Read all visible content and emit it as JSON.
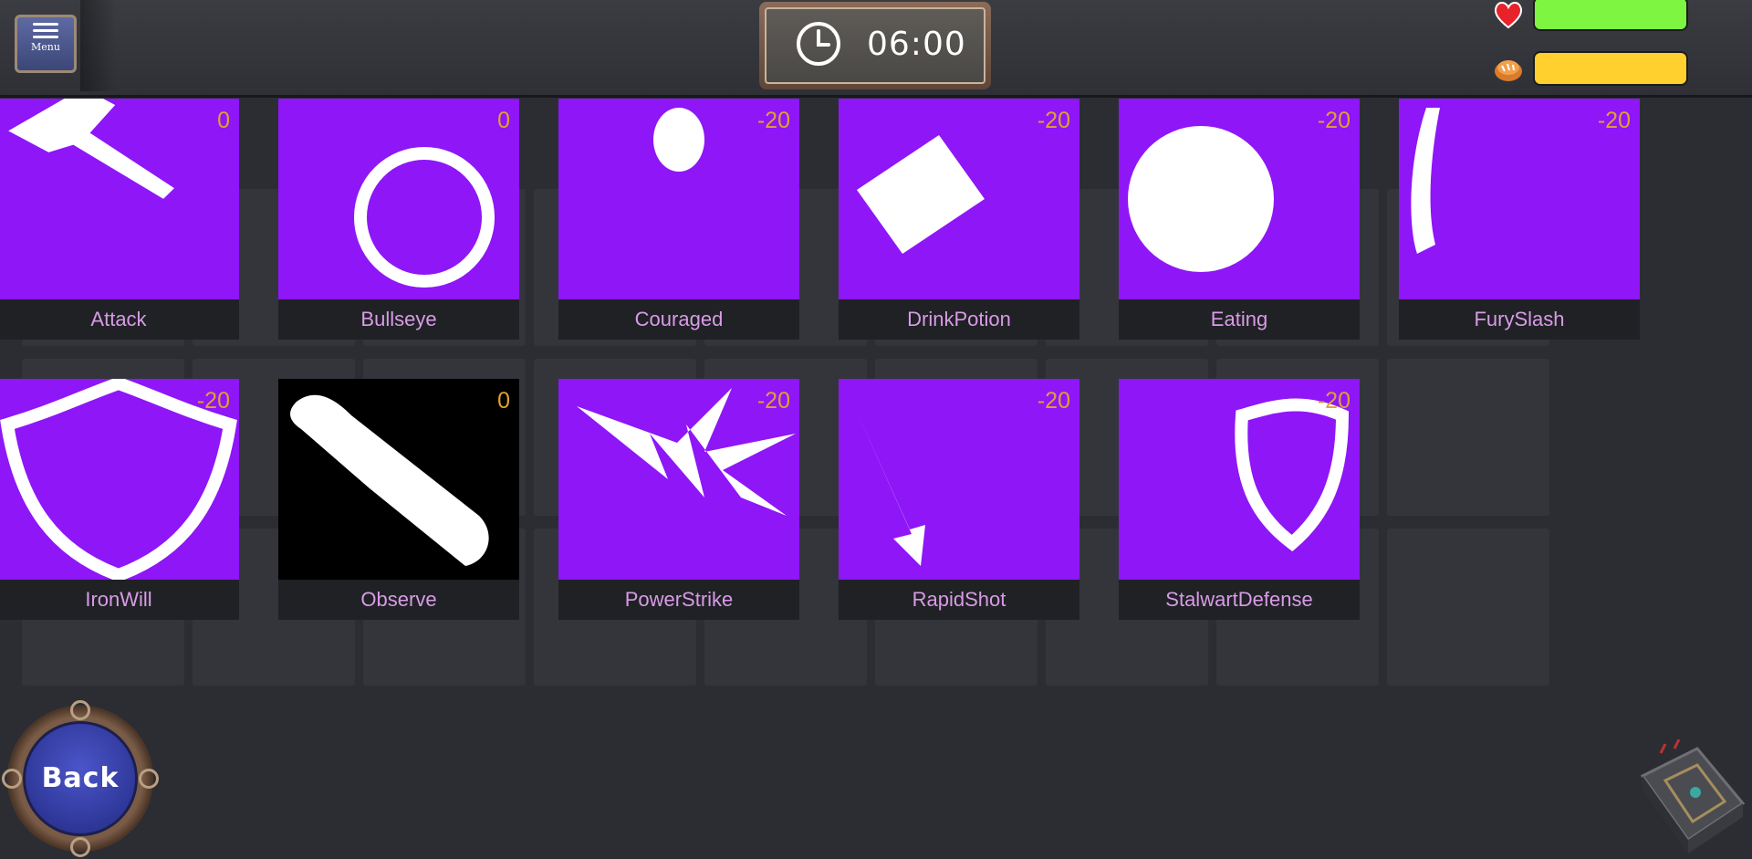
{
  "menu": {
    "label": "Menu",
    "icon": "hamburger-icon"
  },
  "clock": {
    "time": "06:00",
    "icon": "clock-icon"
  },
  "status": {
    "health": {
      "icon": "heart-icon",
      "level": 1.0,
      "color": "#7ef540"
    },
    "food": {
      "icon": "bread-icon",
      "level": 1.0,
      "color": "#ffd02e"
    }
  },
  "skills": [
    {
      "name": "Attack",
      "cost": "0",
      "icon": "sword-grip-icon",
      "bg": "#8e16f7"
    },
    {
      "name": "Bullseye",
      "cost": "0",
      "icon": "bullseye-icon",
      "bg": "#8e16f7"
    },
    {
      "name": "Couraged",
      "cost": "-20",
      "icon": "muscle-icon",
      "bg": "#8e16f7"
    },
    {
      "name": "DrinkPotion",
      "cost": "-20",
      "icon": "potion-icon",
      "bg": "#8e16f7"
    },
    {
      "name": "Eating",
      "cost": "-20",
      "icon": "eating-icon",
      "bg": "#8e16f7"
    },
    {
      "name": "FurySlash",
      "cost": "-20",
      "icon": "slash-icon",
      "bg": "#8e16f7"
    },
    {
      "name": "IronWill",
      "cost": "-20",
      "icon": "shield-arrow-icon",
      "bg": "#8e16f7"
    },
    {
      "name": "Observe",
      "cost": "0",
      "icon": "spyglass-icon",
      "bg": "#000000"
    },
    {
      "name": "PowerStrike",
      "cost": "-20",
      "icon": "power-sword-icon",
      "bg": "#8e16f7"
    },
    {
      "name": "RapidShot",
      "cost": "-20",
      "icon": "arrows-icon",
      "bg": "#8e16f7"
    },
    {
      "name": "StalwartDefense",
      "cost": "-20",
      "icon": "shield-defense-icon",
      "bg": "#8e16f7"
    }
  ],
  "back": {
    "label": "Back"
  },
  "book": {
    "icon": "spellbook-icon"
  }
}
